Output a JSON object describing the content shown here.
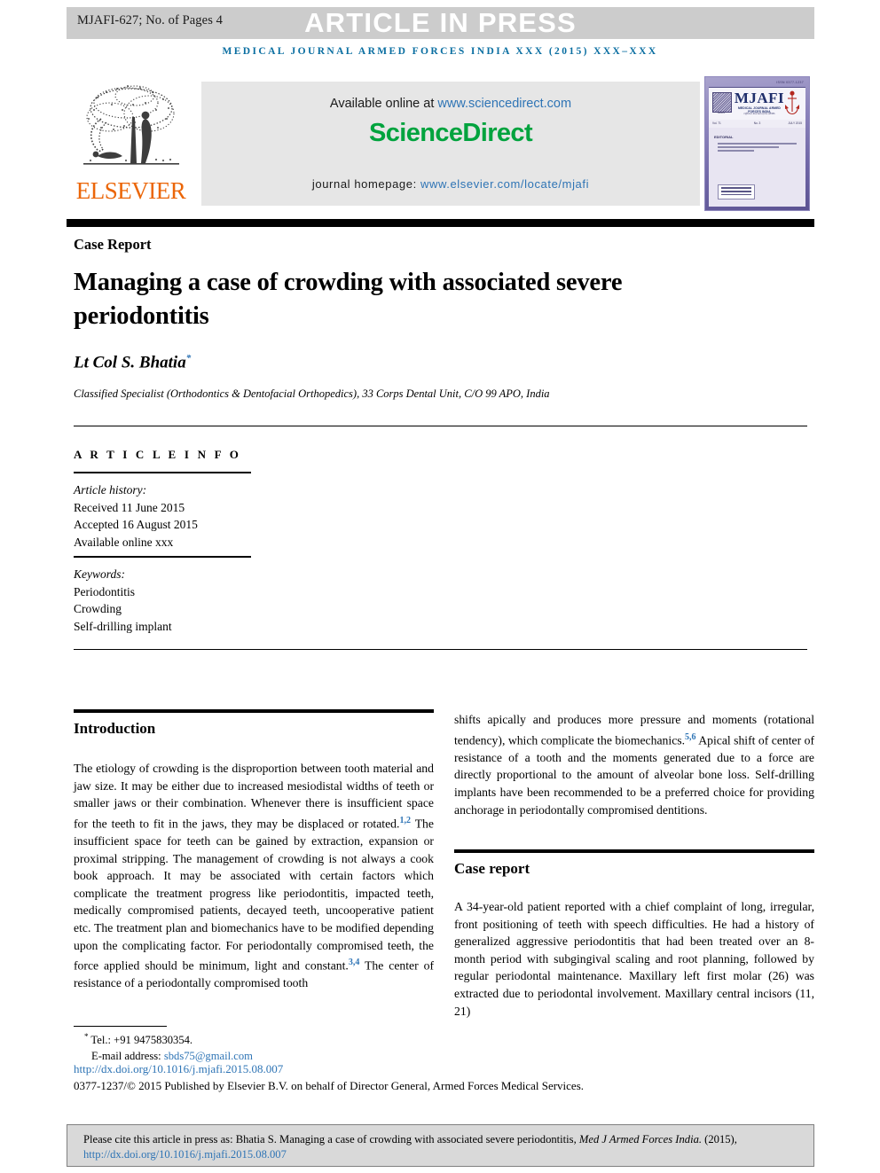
{
  "header": {
    "manuscript_code": "MJAFI-627; No. of Pages 4",
    "status_banner": "ARTICLE IN PRESS",
    "journal_running_head": "MEDICAL JOURNAL ARMED FORCES INDIA XXX (2015) XXX–XXX"
  },
  "masthead": {
    "publisher_name": "ELSEVIER",
    "available_prefix": "Available online at ",
    "available_url": "www.sciencedirect.com",
    "sciencedirect_logo": "ScienceDirect",
    "homepage_prefix": "journal homepage: ",
    "homepage_url": "www.elsevier.com/locate/mjafi",
    "cover": {
      "top_note": "ISSN 0377-1237",
      "title": "MJAFI",
      "subtitle_1": "MEDICAL JOURNAL ARMED FORCES INDIA",
      "subtitle_2": "Official Journal of the AFMS",
      "issue_volume": "Vol. 71",
      "issue_number": "No. 3",
      "issue_date": "JULY 2015",
      "content_heading": "EDITORIAL",
      "emblem_left": "AFMS",
      "emblem_right": "anchor-emblem"
    }
  },
  "article": {
    "type_kicker": "Case Report",
    "title": "Managing a case of crowding with associated severe periodontitis",
    "author": "Lt Col S. Bhatia",
    "author_marker": "*",
    "affiliation": "Classified Specialist (Orthodontics & Dentofacial Orthopedics), 33 Corps Dental Unit, C/O 99 APO, India"
  },
  "article_info": {
    "heading": "A R T I C L E   I N F O",
    "history_label": "Article history:",
    "received": "Received 11 June 2015",
    "accepted": "Accepted 16 August 2015",
    "available_online": "Available online xxx",
    "keywords_label": "Keywords:",
    "keywords": [
      "Periodontitis",
      "Crowding",
      "Self-drilling implant"
    ]
  },
  "body": {
    "introduction": {
      "heading": "Introduction",
      "text_part_1": "The etiology of crowding is the disproportion between tooth material and jaw size. It may be either due to increased mesiodistal widths of teeth or smaller jaws or their combination. Whenever there is insufficient space for the teeth to fit in the jaws, they may be displaced or rotated.",
      "ref_1": "1,2",
      "text_part_2": " The insufficient space for teeth can be gained by extraction, expansion or proximal stripping. The management of crowding is not always a cook book approach. It may be associated with certain factors which complicate the treatment progress like periodontitis, impacted teeth, medically compromised patients, decayed teeth, uncooperative patient etc. The treatment plan and biomechanics have to be modified depending upon the complicating factor. For periodontally compromised teeth, the force applied should be minimum, light and constant.",
      "ref_2": "3,4",
      "text_part_3": " The center of resistance of a periodontally compromised tooth"
    },
    "right_column_continuation": {
      "text_part_1": "shifts apically and produces more pressure and moments (rotational tendency), which complicate the biomechanics.",
      "ref_1": "5,6",
      "text_part_2": " Apical shift of center of resistance of a tooth and the moments generated due to a force are directly proportional to the amount of alveolar bone loss. Self-drilling implants have been recommended to be a preferred choice for providing anchorage in periodontally compromised dentitions."
    },
    "case_report": {
      "heading": "Case report",
      "text": "A 34-year-old patient reported with a chief complaint of long, irregular, front positioning of teeth with speech difficulties. He had a history of generalized aggressive periodontitis that had been treated over an 8-month period with subgingival scaling and root planning, followed by regular periodontal maintenance. Maxillary left first molar (26) was extracted due to periodontal involvement. Maxillary central incisors (11, 21)"
    }
  },
  "footer": {
    "tel_marker": "*",
    "tel": " Tel.: +91 9475830354.",
    "email_label": "E-mail address: ",
    "email": "sbds75@gmail.com",
    "doi": "http://dx.doi.org/10.1016/j.mjafi.2015.08.007",
    "copyright": "0377-1237/© 2015 Published by Elsevier B.V. on behalf of Director General, Armed Forces Medical Services."
  },
  "cite_box": {
    "prefix": "Please cite this article in press as: Bhatia S. Managing a case of crowding with associated severe periodontitis, ",
    "journal_italic": "Med J Armed Forces India.",
    "year": " (2015), ",
    "doi": "http://dx.doi.org/10.1016/j.mjafi.2015.08.007"
  },
  "colors": {
    "link_blue": "#2e74b5",
    "running_head_blue": "#0a6ea1",
    "sciencedirect_green": "#00a33e",
    "elsevier_orange": "#eb6608",
    "banner_gray": "#cccccc",
    "panel_gray": "#e6e6e6",
    "cite_box_gray": "#d9d9d9"
  }
}
